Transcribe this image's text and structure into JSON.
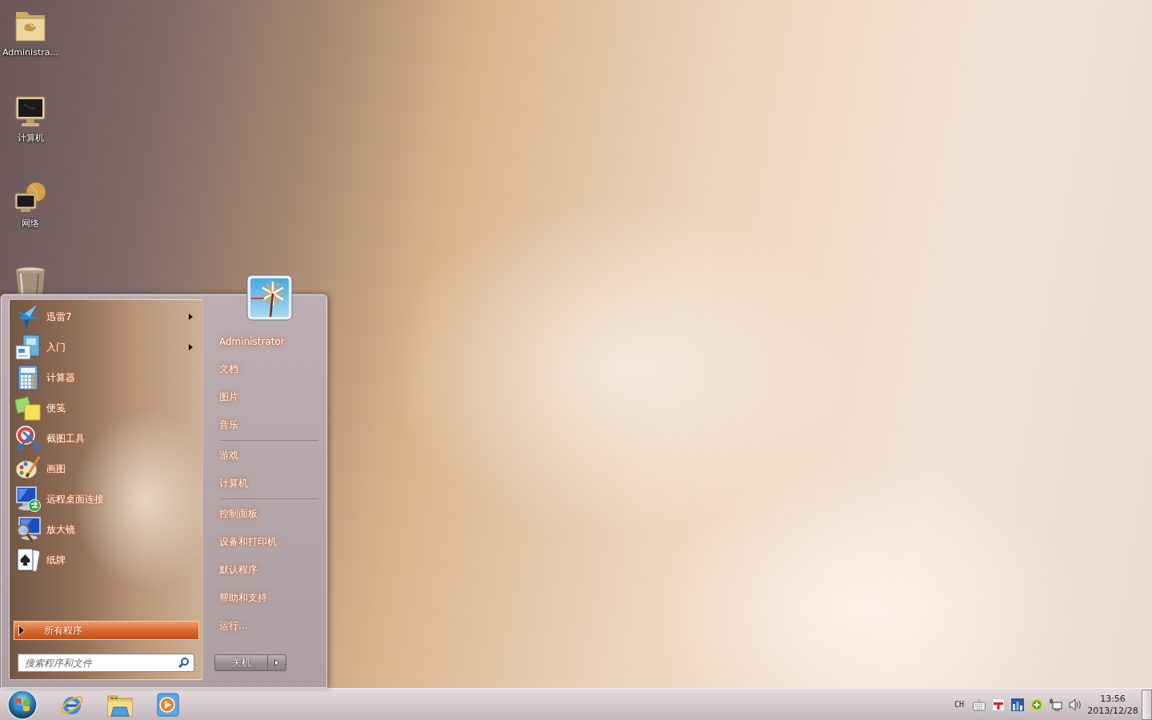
{
  "desktop": {
    "icons": [
      {
        "label": "Administra..."
      },
      {
        "label": "计算机"
      },
      {
        "label": "网络"
      }
    ]
  },
  "start_menu": {
    "programs": [
      {
        "label": "迅雷7",
        "has_submenu": true
      },
      {
        "label": "入门",
        "has_submenu": true
      },
      {
        "label": "计算器",
        "has_submenu": false
      },
      {
        "label": "便笺",
        "has_submenu": false
      },
      {
        "label": "截图工具",
        "has_submenu": false
      },
      {
        "label": "画图",
        "has_submenu": false
      },
      {
        "label": "远程桌面连接",
        "has_submenu": false
      },
      {
        "label": "放大镜",
        "has_submenu": false
      },
      {
        "label": "纸牌",
        "has_submenu": false
      }
    ],
    "all_programs": {
      "label": "所有程序"
    },
    "search": {
      "placeholder": "搜索程序和文件"
    },
    "place_groups": [
      [
        "Administrator",
        "文档",
        "图片",
        "音乐"
      ],
      [
        "游戏",
        "计算机"
      ],
      [
        "控制面板",
        "设备和打印机",
        "默认程序",
        "帮助和支持",
        "运行..."
      ]
    ],
    "shutdown": {
      "label": "关机"
    }
  },
  "taskbar": {
    "tray": {
      "language": "CH",
      "time": "13:56",
      "date": "2013/12/28"
    }
  }
}
